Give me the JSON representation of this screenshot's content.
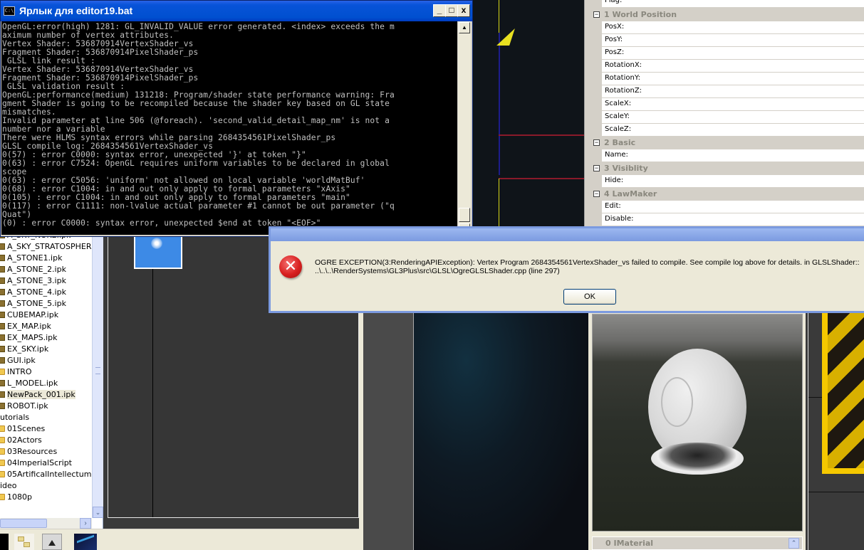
{
  "console": {
    "title": "Ярлык для editor19.bat",
    "icon_label": "C:\\",
    "buttons": {
      "minimize": "_",
      "maximize": "□",
      "close": "x"
    },
    "lines": [
      "OpenGL:error(high) 1281: GL_INVALID_VALUE error generated. <index> exceeds the m",
      "aximum number of vertex attributes.",
      "Vertex Shader: 536870914VertexShader_vs",
      "Fragment Shader: 536870914PixelShader_ps",
      " GLSL link result :",
      "Vertex Shader: 536870914VertexShader_vs",
      "Fragment Shader: 536870914PixelShader_ps",
      " GLSL validation result :",
      "OpenGL:performance(medium) 131218: Program/shader state performance warning: Fra",
      "gment Shader is going to be recompiled because the shader key based on GL state",
      "mismatches.",
      "Invalid parameter at line 506 (@foreach). 'second_valid_detail_map_nm' is not a",
      "number nor a variable",
      "There were HLMS syntax errors while parsing 2684354561PixelShader_ps",
      "GLSL compile log: 2684354561VertexShader_vs",
      "0(57) : error C0000: syntax error, unexpected '}' at token \"}\"",
      "0(63) : error C7524: OpenGL requires uniform variables to be declared in global",
      "scope",
      "0(63) : error C5056: 'uniform' not allowed on local variable 'worldMatBuf'",
      "0(68) : error C1004: in and out only apply to formal parameters \"xAxis\"",
      "0(105) : error C1004: in and out only apply to formal parameters \"main\"",
      "0(117) : error C1111: non-lvalue actual parameter #1 cannot be out parameter (\"q",
      "Quat\")",
      "(0) : error C0000: syntax error, unexpected $end at token \"<EOF>\""
    ]
  },
  "properties": {
    "top_row": "Flag:",
    "categories": [
      {
        "label": "1 World Position",
        "toggle": "−",
        "fields": [
          "PosX:",
          "PosY:",
          "PosZ:",
          "RotationX:",
          "RotationY:",
          "RotationZ:",
          "ScaleX:",
          "ScaleY:",
          "ScaleZ:"
        ]
      },
      {
        "label": "2 Basic",
        "toggle": "−",
        "fields": [
          "Name:"
        ]
      },
      {
        "label": "3 Visiblity",
        "toggle": "−",
        "fields": [
          "Hide:"
        ]
      },
      {
        "label": "4 LawMaker",
        "toggle": "−",
        "fields": [
          " Edit:",
          "Disable:"
        ]
      }
    ]
  },
  "tree": {
    "items": [
      {
        "label": "A_SKY_NUKE.ipk",
        "type": "package",
        "indent": 1
      },
      {
        "label": "A_SKY_STRATOSPHERE",
        "type": "package",
        "indent": 1
      },
      {
        "label": "A_STONE1.ipk",
        "type": "package",
        "indent": 1
      },
      {
        "label": "A_STONE_2.ipk",
        "type": "package",
        "indent": 1
      },
      {
        "label": "A_STONE_3.ipk",
        "type": "package",
        "indent": 1
      },
      {
        "label": "A_STONE_4.ipk",
        "type": "package",
        "indent": 1
      },
      {
        "label": "A_STONE_5.ipk",
        "type": "package",
        "indent": 1
      },
      {
        "label": "CUBEMAP.ipk",
        "type": "package",
        "indent": 1
      },
      {
        "label": "EX_MAP.ipk",
        "type": "package",
        "indent": 1
      },
      {
        "label": "EX_MAPS.ipk",
        "type": "package",
        "indent": 1
      },
      {
        "label": "EX_SKY.ipk",
        "type": "package",
        "indent": 1
      },
      {
        "label": "GUI.ipk",
        "type": "package",
        "indent": 1
      },
      {
        "label": "INTRO",
        "type": "folder",
        "indent": 1
      },
      {
        "label": "L_MODEL.ipk",
        "type": "package",
        "indent": 1
      },
      {
        "label": "NewPack_001.ipk",
        "type": "package",
        "indent": 1,
        "selected": true
      },
      {
        "label": "ROBOT.ipk",
        "type": "package",
        "indent": 1
      },
      {
        "label": "utorials",
        "type": "root",
        "indent": 0
      },
      {
        "label": "01Scenes",
        "type": "folder",
        "indent": 1
      },
      {
        "label": "02Actors",
        "type": "folder",
        "indent": 1
      },
      {
        "label": "03Resources",
        "type": "folder",
        "indent": 1
      },
      {
        "label": "04ImperialScript",
        "type": "folder",
        "indent": 1
      },
      {
        "label": "05ArtificalIntellectum",
        "type": "folder",
        "indent": 1
      },
      {
        "label": "ideo",
        "type": "root",
        "indent": 0
      },
      {
        "label": "1080p",
        "type": "folder",
        "indent": 1
      }
    ],
    "scroll_down": "⌄",
    "scroll_right": "›"
  },
  "dialog": {
    "message_line1": "OGRE EXCEPTION(3:RenderingAPIException): Vertex Program 2684354561VertexShader_vs failed to compile. See compile log above for details. in GLSLShader::",
    "message_line2": "..\\..\\..\\RenderSystems\\GL3Plus\\src\\GLSL\\OgreGLSLShader.cpp (line 297)",
    "icon": "✕",
    "ok_label": "OK"
  },
  "material_panel": {
    "header": "0 IMaterial",
    "up_arrow": "⌃"
  },
  "colors": {
    "titlebar": "#0050d0",
    "console_bg": "#000000",
    "console_fg": "#c0c0c0",
    "category_text": "#8a887e",
    "dialog_bg": "#ece9d8",
    "error_red": "#d82020"
  }
}
